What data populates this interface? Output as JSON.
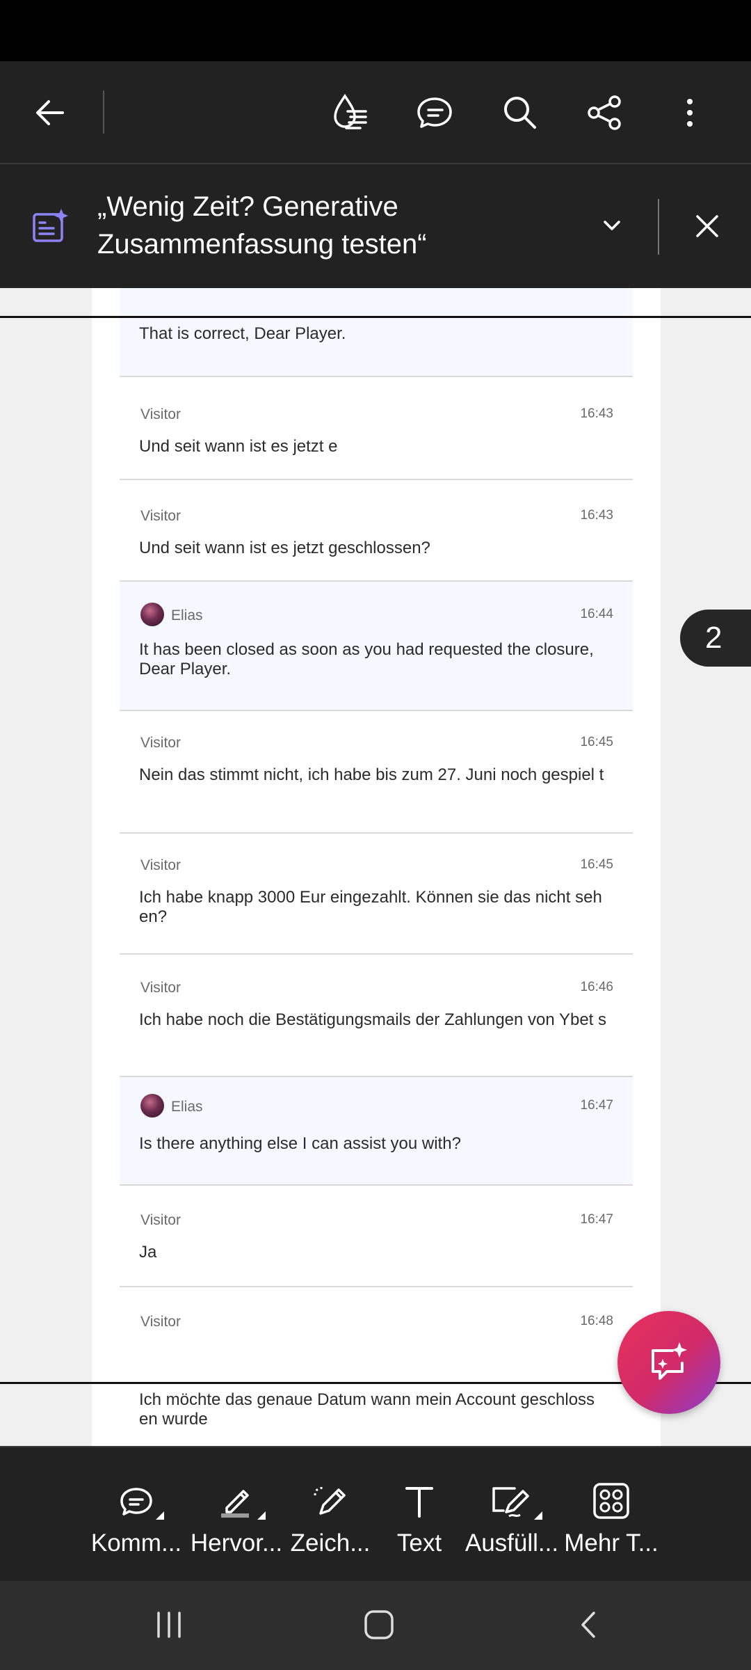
{
  "summary_banner": {
    "title": "„Wenig Zeit? Generative Zusammenfassung testen“"
  },
  "chat": {
    "partial_message": "That is correct, Dear Player.",
    "messages": [
      {
        "sender": "Visitor",
        "time": "16:43",
        "text": "Und seit wann ist es jetzt e"
      },
      {
        "sender": "Visitor",
        "time": "16:43",
        "text": "Und seit wann ist es jetzt geschlossen?"
      },
      {
        "sender": "Elias",
        "time": "16:44",
        "text": "It has been closed as soon as you had requested the closure, Dear Player."
      },
      {
        "sender": "Visitor",
        "time": "16:45",
        "text": "Nein das stimmt nicht, ich habe bis zum 27. Juni noch gespiel t"
      },
      {
        "sender": "Visitor",
        "time": "16:45",
        "text": "Ich habe knapp 3000 Eur eingezahlt. Können sie das nicht seh en?"
      },
      {
        "sender": "Visitor",
        "time": "16:46",
        "text": "Ich habe noch die Bestätigungsmails der Zahlungen von Ybet s"
      },
      {
        "sender": "Elias",
        "time": "16:47",
        "text": "Is there anything else I can assist you with?"
      },
      {
        "sender": "Visitor",
        "time": "16:47",
        "text": "Ja"
      },
      {
        "sender": "Visitor",
        "time": "16:48",
        "text": ""
      }
    ],
    "next_page_message": "Ich möchte das genaue Datum wann mein Account geschloss en wurde"
  },
  "page_badge": "2",
  "bottom_toolbar": {
    "items": [
      {
        "label": "Komm...",
        "icon": "comment-icon"
      },
      {
        "label": "Hervor...",
        "icon": "highlight-icon"
      },
      {
        "label": "Zeich...",
        "icon": "draw-icon"
      },
      {
        "label": "Text",
        "icon": "text-icon"
      },
      {
        "label": "Ausfüll...",
        "icon": "fill-sign-icon"
      },
      {
        "label": "Mehr T...",
        "icon": "more-tools-icon"
      }
    ]
  },
  "colors": {
    "toolbar_bg": "#222222",
    "agent_message_bg": "#f5f8ff",
    "ai_accent": "#7b6cf0",
    "fab_gradient_start": "#e8325a",
    "fab_gradient_end": "#8a3fd0"
  }
}
